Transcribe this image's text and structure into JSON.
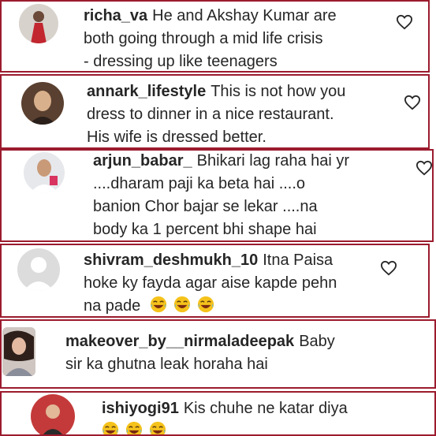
{
  "comments": [
    {
      "username": "richa_va",
      "lines": [
        "He and Akshay Kumar are",
        "both going through a mid life crisis",
        "- dressing up like teenagers"
      ]
    },
    {
      "username": "annark_lifestyle",
      "lines": [
        "This is not how you",
        "dress to dinner in a nice restaurant.",
        "His wife is dressed better."
      ]
    },
    {
      "username": "arjun_babar_",
      "lines": [
        "Bhikari lag raha hai yr",
        "....dharam paji ka beta hai ....o",
        "banion Chor bajar se lekar ....na",
        "body ka 1 percent bhi shape hai"
      ]
    },
    {
      "username": "shivram_deshmukh_10",
      "lines": [
        "Itna Paisa",
        "hoke ky fayda agar aise kapde pehn",
        "na pade"
      ],
      "emoji_count": 3,
      "emoji_icon": "face-with-tears-of-joy-icon"
    },
    {
      "username": "makeover_by__nirmaladeepak",
      "lines": [
        "Baby",
        "sir ka ghutna leak horaha hai"
      ]
    },
    {
      "username": "ishiyogi91",
      "lines": [
        "Kis chuhe ne katar diya"
      ],
      "emoji_count": 3,
      "emoji_icon": "face-with-tears-of-joy-icon"
    }
  ],
  "colors": {
    "border": "#9b1b2e",
    "text": "#262626",
    "heart": "#262626"
  }
}
